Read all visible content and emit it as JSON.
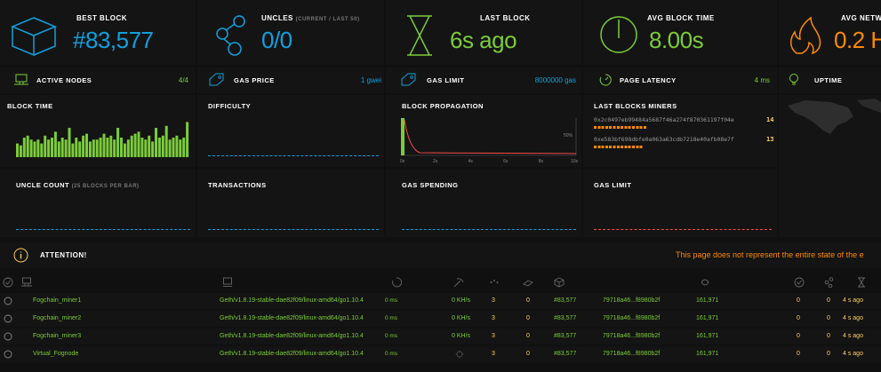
{
  "colors": {
    "blue": "#10a0de",
    "green": "#7bcc3a",
    "orange": "#ff8a00",
    "yellow": "#ffd162",
    "red": "#f74b4b",
    "dim": "#9a9a9a"
  },
  "top": {
    "best_block": {
      "label": "BEST BLOCK",
      "value": "#83,577",
      "icon": "cube-icon"
    },
    "uncles": {
      "label": "UNCLES",
      "sublabel": "(CURRENT / LAST 50)",
      "value": "0/0",
      "icon": "uncles-icon"
    },
    "last_block": {
      "label": "LAST BLOCK",
      "value": "6s ago",
      "icon": "hourglass-icon"
    },
    "avg_block_time": {
      "label": "AVG BLOCK TIME",
      "value": "8.00s",
      "icon": "gauge-icon"
    },
    "avg_network": {
      "label": "AVG NETW",
      "value": "0.2 H",
      "icon": "fire-icon"
    }
  },
  "stats": {
    "active_nodes": {
      "label": "ACTIVE NODES",
      "value": "4/4"
    },
    "gas_price": {
      "label": "GAS PRICE",
      "value": "1 gwei"
    },
    "gas_limit": {
      "label": "GAS LIMIT",
      "value": "8000000 gas"
    },
    "page_latency": {
      "label": "PAGE LATENCY",
      "value": "4 ms"
    },
    "uptime": {
      "label": "UPTIME"
    }
  },
  "charts": {
    "block_time": "BLOCK TIME",
    "difficulty": "DIFFICULTY",
    "block_propagation": "BLOCK PROPAGATION",
    "last_blocks_miners": "LAST BLOCKS MINERS",
    "uncle_count": "UNCLE COUNT",
    "uncle_count_sub": "(25 BLOCKS PER BAR)",
    "transactions": "TRANSACTIONS",
    "gas_spending": "GAS SPENDING",
    "gas_limit": "GAS LIMIT"
  },
  "chart_data": {
    "type": "bar",
    "block_time_bars": [
      0.35,
      0.3,
      0.5,
      0.55,
      0.45,
      0.4,
      0.45,
      0.35,
      0.55,
      0.45,
      0.5,
      0.65,
      0.4,
      0.5,
      0.45,
      0.75,
      0.35,
      0.5,
      0.4,
      0.55,
      0.6,
      0.4,
      0.45,
      0.45,
      0.5,
      0.6,
      0.5,
      0.55,
      0.45,
      0.75,
      0.5,
      0.35,
      0.45,
      0.55,
      0.6,
      0.65,
      0.5,
      0.45,
      0.55,
      0.4,
      0.75,
      0.5,
      0.55,
      0.8,
      0.45,
      0.5,
      0.55,
      0.45,
      0.5,
      0.9
    ],
    "propagation": {
      "xticks": [
        "0s",
        "2s",
        "4s",
        "6s",
        "8s",
        "10s"
      ],
      "ylabel": "50%"
    }
  },
  "miners": [
    {
      "address": "0x2c0497eb99484a5687f46a274f870361197f04e",
      "count": "14"
    },
    {
      "address": "0xe583bf698dbfe0a063a63cdb7218e40afb08e7f",
      "count": "13"
    }
  ],
  "attention": {
    "label": "ATTENTION!",
    "message": "This page does not represent the entire state of the e"
  },
  "nodes": [
    {
      "name": "Fogchain_miner1",
      "client": "Geth/v1.8.19-stable-dae82f09/linux-amd64/go1.10.4",
      "latency": "0 ms",
      "hashrate": "0 KH/s",
      "peers": "3",
      "pending": "0",
      "block": "#83,577",
      "hash": "79718a46...f8980b2f",
      "difficulty": "161,971",
      "uncles1": "0",
      "uncles2": "0",
      "time": "4 s ago"
    },
    {
      "name": "Fogchain_miner2",
      "client": "Geth/v1.8.19-stable-dae82f09/linux-amd64/go1.10.4",
      "latency": "0 ms",
      "hashrate": "0 KH/s",
      "peers": "3",
      "pending": "0",
      "block": "#83,577",
      "hash": "79718a46...f8980b2f",
      "difficulty": "161,971",
      "uncles1": "0",
      "uncles2": "0",
      "time": "4 s ago"
    },
    {
      "name": "Fogchain_miner3",
      "client": "Geth/v1.8.19-stable-dae82f09/linux-amd64/go1.10.4",
      "latency": "0 ms",
      "hashrate": "0 KH/s",
      "peers": "3",
      "pending": "0",
      "block": "#83,577",
      "hash": "79718a46...f8980b2f",
      "difficulty": "161,971",
      "uncles1": "0",
      "uncles2": "0",
      "time": "4 s ago"
    },
    {
      "name": "Virtual_Fognode",
      "client": "Geth/v1.8.19-stable-dae82f09/linux-amd64/go1.10.4",
      "latency": "0 ms",
      "hashrate": "",
      "peers": "3",
      "pending": "0",
      "block": "#83,577",
      "hash": "79718a46...f8980b2f",
      "difficulty": "161,971",
      "uncles1": "0",
      "uncles2": "0",
      "time": "4 s ago"
    }
  ]
}
